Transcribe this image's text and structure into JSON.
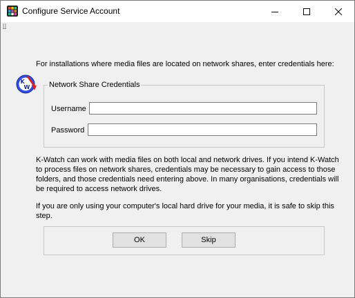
{
  "window": {
    "title": "Configure Service Account"
  },
  "icons": {
    "app": "app-grid-icon",
    "minimize": "minimize-icon",
    "maximize": "maximize-icon",
    "close": "close-icon",
    "logo": "kwatch-logo-icon"
  },
  "colors": {
    "titlebar": "#ffffff",
    "client": "#f0f0f0",
    "button": "#e1e1e1",
    "logo_blue": "#2f4fe0",
    "logo_red": "#e02020"
  },
  "main": {
    "intro": "For installations where media files are located on network shares, enter credentials here:",
    "group_title": "Network Share Credentials",
    "username_label": "Username",
    "username_value": "",
    "password_label": "Password",
    "password_value": "",
    "info_text": "K-Watch can work with media files on both local and network drives. If you intend K-Watch to process files on network shares, credentials may be necessary to gain access to those folders, and those credentials need entering above. In many organisations, credentials will be required to access network drives.",
    "skip_text": "If you are only using your computer's local hard drive for your media, it is safe to skip this step."
  },
  "buttons": {
    "ok": "OK",
    "skip": "Skip"
  }
}
